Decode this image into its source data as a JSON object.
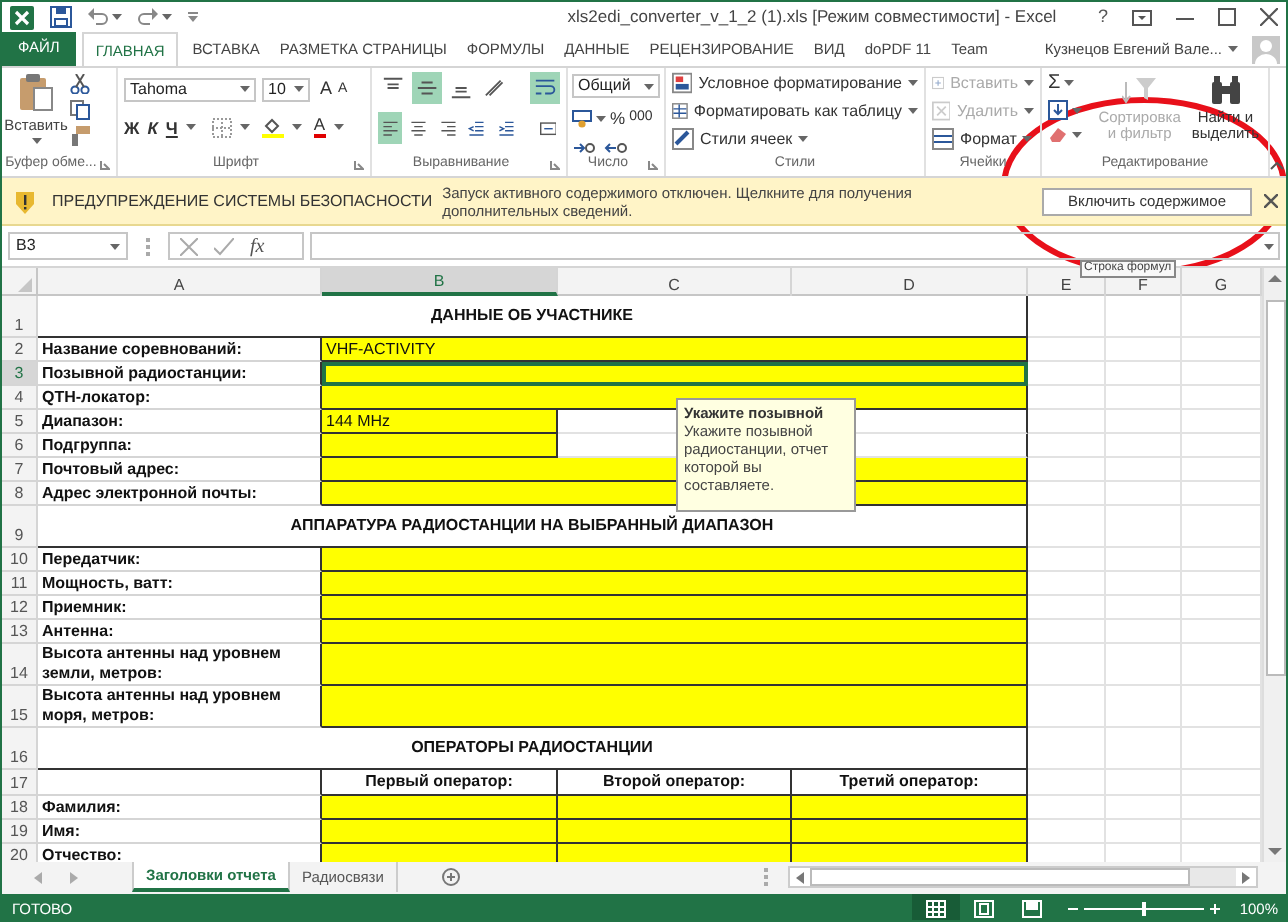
{
  "window": {
    "title": "xls2edi_converter_v_1_2 (1).xls  [Режим совместимости] - Excel",
    "help": "?"
  },
  "ribbon_tabs": [
    {
      "label": "ФАЙЛ",
      "kind": "file",
      "selected": false
    },
    {
      "label": "ГЛАВНАЯ",
      "kind": "tab",
      "selected": true
    },
    {
      "label": "ВСТАВКА",
      "kind": "tab",
      "selected": false
    },
    {
      "label": "РАЗМЕТКА СТРАНИЦЫ",
      "kind": "tab",
      "selected": false
    },
    {
      "label": "ФОРМУЛЫ",
      "kind": "tab",
      "selected": false
    },
    {
      "label": "ДАННЫЕ",
      "kind": "tab",
      "selected": false
    },
    {
      "label": "РЕЦЕНЗИРОВАНИЕ",
      "kind": "tab",
      "selected": false
    },
    {
      "label": "ВИД",
      "kind": "tab",
      "selected": false
    },
    {
      "label": "doPDF 11",
      "kind": "tab",
      "selected": false
    },
    {
      "label": "Team",
      "kind": "tab",
      "selected": false
    }
  ],
  "account": {
    "user": "Кузнецов Евгений Вале..."
  },
  "ribbon": {
    "clipboard": {
      "paste": "Вставить",
      "label": "Буфер обме..."
    },
    "font": {
      "name": "Tahoma",
      "size": "10",
      "grow": "A",
      "shrink": "A",
      "bold": "Ж",
      "italic": "К",
      "underline": "Ч",
      "font_color": "А",
      "label": "Шрифт"
    },
    "alignment": {
      "label": "Выравнивание",
      "buttons": [
        {
          "kind": "top",
          "selected": false
        },
        {
          "kind": "middle",
          "selected": true
        },
        {
          "kind": "bottom",
          "selected": false
        },
        {
          "kind": "orientation",
          "selected": false
        },
        {
          "kind": "wrap",
          "selected": true
        },
        {
          "kind": "left",
          "selected": true
        },
        {
          "kind": "center",
          "selected": false
        },
        {
          "kind": "right",
          "selected": false
        },
        {
          "kind": "outdent",
          "selected": false
        },
        {
          "kind": "indent",
          "selected": false
        },
        {
          "kind": "merge",
          "selected": false
        }
      ]
    },
    "number": {
      "format": "Общий",
      "percent": "%",
      "thousands": "000",
      "label": "Число"
    },
    "styles": {
      "items": [
        "Условное форматирование",
        "Форматировать как таблицу",
        "Стили ячеек"
      ],
      "label": "Стили"
    },
    "cells": {
      "items": [
        {
          "label": "Вставить",
          "disabled": true
        },
        {
          "label": "Удалить",
          "disabled": true
        },
        {
          "label": "Формат",
          "disabled": false
        }
      ],
      "label": "Ячейки"
    },
    "editing": {
      "sum": "Σ",
      "sort": {
        "label": "Сортировка и фильтр",
        "disabled": true
      },
      "find": {
        "label": "Найти и выделить",
        "disabled": false
      },
      "label": "Редактирование"
    }
  },
  "security_bar": {
    "title": "ПРЕДУПРЕЖДЕНИЕ СИСТЕМЫ БЕЗОПАСНОСТИ",
    "message": "Запуск активного содержимого отключен. Щелкните для получения дополнительных сведений.",
    "button": "Включить содержимое"
  },
  "formula_bar": {
    "name_box": "B3",
    "fx": "fx",
    "tooltip": "Строка формул"
  },
  "sheet": {
    "columns": [
      {
        "label": "A",
        "selected": false
      },
      {
        "label": "B",
        "selected": true
      },
      {
        "label": "C",
        "selected": false
      },
      {
        "label": "D",
        "selected": false
      },
      {
        "label": "E",
        "selected": false
      },
      {
        "label": "F",
        "selected": false
      },
      {
        "label": "G",
        "selected": false
      }
    ],
    "rows": [
      {
        "number": "1",
        "kind": "section",
        "title": "ДАННЫЕ ОБ УЧАСТНИКЕ",
        "selected": false
      },
      {
        "number": "2",
        "kind": "field",
        "label": "Название соревнований:",
        "value": "VHF-ACTIVITY",
        "selected": false
      },
      {
        "number": "3",
        "kind": "field",
        "label": "Позывной радиостанции:",
        "selected": true
      },
      {
        "number": "4",
        "kind": "field",
        "label": "QTH-локатор:",
        "selected": false
      },
      {
        "number": "5",
        "kind": "split",
        "label": "Диапазон:",
        "value": "144 MHz",
        "selected": false
      },
      {
        "number": "6",
        "kind": "split",
        "label": "Подгруппа:",
        "selected": false
      },
      {
        "number": "7",
        "kind": "field",
        "label": "Почтовый адрес:",
        "selected": false
      },
      {
        "number": "8",
        "kind": "field",
        "label": "Адрес электронной почты:",
        "selected": false
      },
      {
        "number": "9",
        "kind": "section",
        "title": "АППАРАТУРА РАДИОСТАНЦИИ НА ВЫБРАННЫЙ ДИАПАЗОН",
        "selected": false
      },
      {
        "number": "10",
        "kind": "field",
        "label": "Передатчик:",
        "selected": false
      },
      {
        "number": "11",
        "kind": "field",
        "label": "Мощность, ватт:",
        "selected": false
      },
      {
        "number": "12",
        "kind": "field",
        "label": "Приемник:",
        "selected": false
      },
      {
        "number": "13",
        "kind": "field",
        "label": "Антенна:",
        "selected": false
      },
      {
        "number": "14",
        "kind": "field",
        "label": "Высота антенны над уровнем земли, метров:",
        "selected": false
      },
      {
        "number": "15",
        "kind": "field",
        "label": "Высота антенны над уровнем моря, метров:",
        "selected": false
      },
      {
        "number": "16",
        "kind": "section",
        "title": "ОПЕРАТОРЫ РАДИОСТАНЦИИ",
        "selected": false
      },
      {
        "number": "17",
        "kind": "headers",
        "cells": [
          "Первый оператор:",
          "Второй оператор:",
          "Третий оператор:"
        ],
        "selected": false
      },
      {
        "number": "18",
        "kind": "operators",
        "label": "Фамилия:",
        "selected": false
      },
      {
        "number": "19",
        "kind": "operators",
        "label": "Имя:",
        "selected": false
      },
      {
        "number": "20",
        "kind": "operators",
        "label": "Отчество:",
        "selected": false
      }
    ]
  },
  "input_message": {
    "title": "Укажите позывной",
    "text": "Укажите позывной радиостанции, отчет которой вы составляете."
  },
  "sheet_tabs": [
    {
      "label": "Заголовки отчета",
      "selected": true
    },
    {
      "label": "Радиосвязи",
      "selected": false
    }
  ],
  "status_bar": {
    "status": "ГОТОВО",
    "views": [
      {
        "kind": "normal",
        "selected": true
      },
      {
        "kind": "page_layout",
        "selected": false
      },
      {
        "kind": "page_break",
        "selected": false
      }
    ],
    "zoom": {
      "level": 0.5,
      "reading": "100%"
    }
  },
  "annotation": {
    "kind": "ellipse"
  }
}
